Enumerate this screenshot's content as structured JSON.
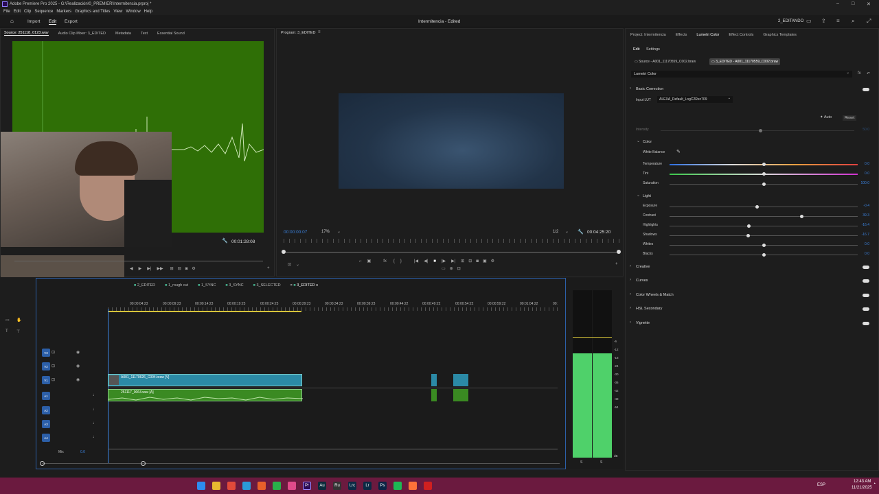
{
  "app": {
    "title": "Adobe Premiere Pro 2025 - G:\\Realización\\0_PREMIER\\Intermitencia.prproj *"
  },
  "menu": [
    "File",
    "Edit",
    "Clip",
    "Sequence",
    "Markers",
    "Graphics and Titles",
    "View",
    "Window",
    "Help"
  ],
  "workspace": {
    "tabs": [
      "Import",
      "Edit",
      "Export"
    ],
    "active": "Edit",
    "doc_title": "Intermitencia - Edited",
    "right_label": "2_EDITANDO"
  },
  "source": {
    "tabs": [
      "Source: 251118_0123.wav",
      "Audio Clip Mixer: 3_EDITED",
      "Metadata",
      "Text",
      "Essential Sound"
    ],
    "timecode": "00:01:28:08"
  },
  "program": {
    "title": "Program: 3_EDITED",
    "timecode": "00:00:00:07",
    "zoom": "17%",
    "resolution": "1/2",
    "duration": "00:04:25:20"
  },
  "right_tabs": [
    "Project: Intermitencia",
    "Effects",
    "Lumetri Color",
    "Effect Controls",
    "Graphics Templates"
  ],
  "lumetri": {
    "subtabs": [
      "Edit",
      "Settings"
    ],
    "source_clip": "Source - A001_11170559_C002.braw",
    "seq_clip": "3_EDITED - A001_11170559_C002.braw",
    "effect": "Lumetri Color",
    "basic": "Basic Correction",
    "input_lut_label": "Input LUT",
    "input_lut": "ALEXA_Default_LogC2Rec709",
    "auto": "Auto",
    "reset": "Reset",
    "intensity_label": "Intensity",
    "intensity_val": "50.0",
    "color_label": "Color",
    "wb_label": "White Balance",
    "temperature": {
      "label": "Temperature",
      "val": "0.0"
    },
    "tint": {
      "label": "Tint",
      "val": "0.0"
    },
    "saturation": {
      "label": "Saturation",
      "val": "100.0"
    },
    "light_label": "Light",
    "exposure": {
      "label": "Exposure",
      "val": "-0.4"
    },
    "contrast": {
      "label": "Contrast",
      "val": "39.3"
    },
    "highlights": {
      "label": "Highlights",
      "val": "-16.4"
    },
    "shadows": {
      "label": "Shadows",
      "val": "-16.7"
    },
    "whites": {
      "label": "Whites",
      "val": "0.0"
    },
    "blacks": {
      "label": "Blacks",
      "val": "0.0"
    },
    "sections": [
      "Creative",
      "Curves",
      "Color Wheels & Match",
      "HSL Secondary",
      "Vignette"
    ]
  },
  "timeline": {
    "seq_tabs": [
      "2_EDITED",
      "1_rough cut",
      "1_SYNC",
      "3_SYNC",
      "3_SELECTED",
      "3_EDITED"
    ],
    "ruler": [
      "00:00:04:23",
      "00:00:09:23",
      "00:00:14:23",
      "00:00:19:23",
      "00:00:24:23",
      "00:00:29:23",
      "00:00:34:23",
      "00:00:39:23",
      "00:00:44:22",
      "00:00:49:22",
      "00:00:54:22",
      "00:00:59:22",
      "00:01:04:22",
      "00:"
    ],
    "video_tracks": [
      "V3",
      "V2",
      "V1"
    ],
    "audio_tracks": [
      "A1",
      "A2",
      "A3",
      "A4"
    ],
    "mix_label": "Mix",
    "mix_val": "0.0",
    "v_clip": "A001_11170626_C004.braw [V]",
    "a_clip": "251117_0064.wav [A]"
  },
  "meter_scale": [
    "-6",
    "-12",
    "-18",
    "-24",
    "-30",
    "-36",
    "-42",
    "-48",
    "-54",
    "dB"
  ],
  "meter_ss": [
    "S",
    "S"
  ],
  "tray": {
    "lang": "ESP",
    "time": "12:43 AM",
    "date": "11/21/2025"
  }
}
